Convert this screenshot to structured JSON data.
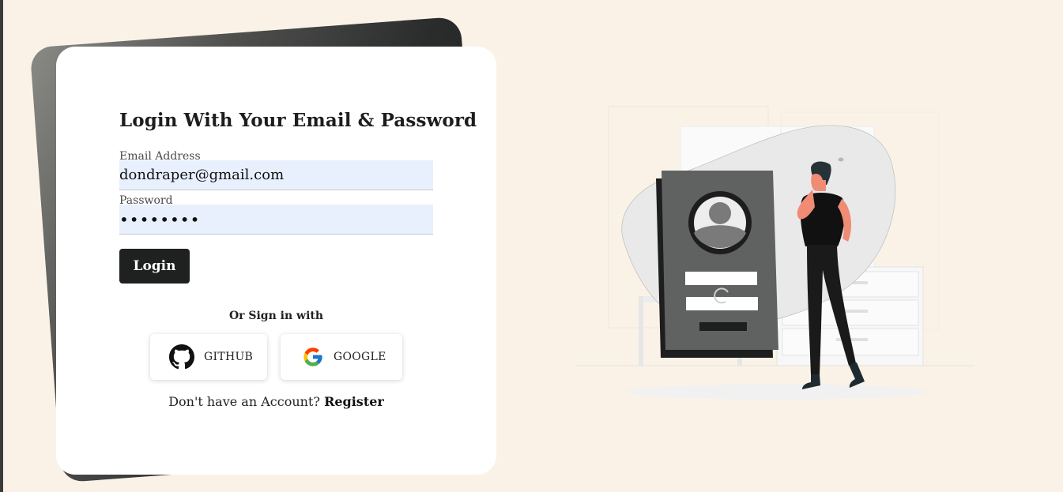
{
  "login": {
    "title": "Login With Your Email & Password",
    "email_label": "Email Address",
    "email_value": "dondraper@gmail.com",
    "password_label": "Password",
    "password_value": "password",
    "login_button": "Login",
    "or_text": "Or Sign in with",
    "github_label": "GITHUB",
    "google_label": "GOOGLE",
    "register_prompt": "Don't have an Account?",
    "register_link": "Register"
  },
  "icons": {
    "github": "github-icon",
    "google": "google-icon"
  },
  "colors": {
    "background": "#fbf2e7",
    "card": "#ffffff",
    "button": "#1f2121",
    "input_fill": "#e8f0fe",
    "accent_skin": "#f08b74"
  }
}
